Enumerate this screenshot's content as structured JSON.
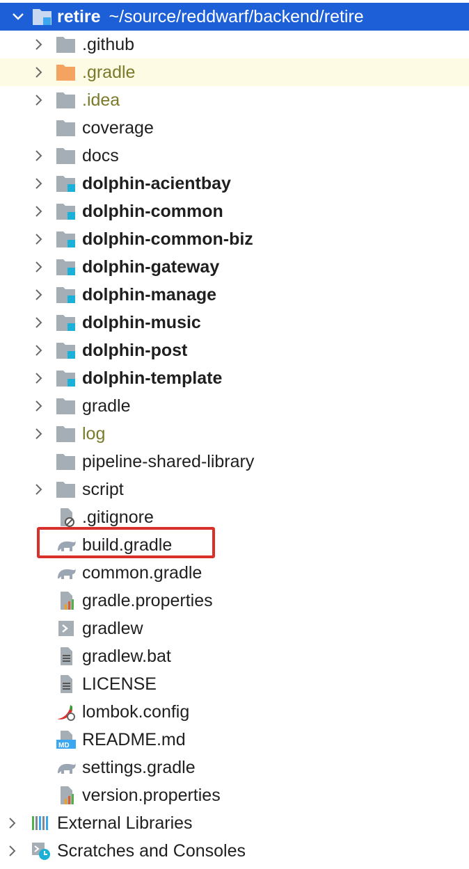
{
  "root": {
    "name": "retire",
    "path": "~/source/reddwarf/backend/retire"
  },
  "items": [
    {
      "label": ".github"
    },
    {
      "label": ".gradle"
    },
    {
      "label": ".idea"
    },
    {
      "label": "coverage"
    },
    {
      "label": "docs"
    },
    {
      "label": "dolphin-acientbay"
    },
    {
      "label": "dolphin-common"
    },
    {
      "label": "dolphin-common-biz"
    },
    {
      "label": "dolphin-gateway"
    },
    {
      "label": "dolphin-manage"
    },
    {
      "label": "dolphin-music"
    },
    {
      "label": "dolphin-post"
    },
    {
      "label": "dolphin-template"
    },
    {
      "label": "gradle"
    },
    {
      "label": "log"
    },
    {
      "label": "pipeline-shared-library"
    },
    {
      "label": "script"
    },
    {
      "label": ".gitignore"
    },
    {
      "label": "build.gradle"
    },
    {
      "label": "common.gradle"
    },
    {
      "label": "gradle.properties"
    },
    {
      "label": "gradlew"
    },
    {
      "label": "gradlew.bat"
    },
    {
      "label": "LICENSE"
    },
    {
      "label": "lombok.config"
    },
    {
      "label": "README.md"
    },
    {
      "label": "settings.gradle"
    },
    {
      "label": "version.properties"
    }
  ],
  "footer": [
    {
      "label": "External Libraries"
    },
    {
      "label": "Scratches and Consoles"
    }
  ],
  "colors": {
    "selection": "#1d5fd6",
    "highlight_row": "#fdfbe3",
    "box": "#d8302a",
    "module_square": "#1ab0d8",
    "folder": "#a6aeb5",
    "gradle_folder": "#f4a460",
    "ignored_text": "#7a7a2a"
  }
}
